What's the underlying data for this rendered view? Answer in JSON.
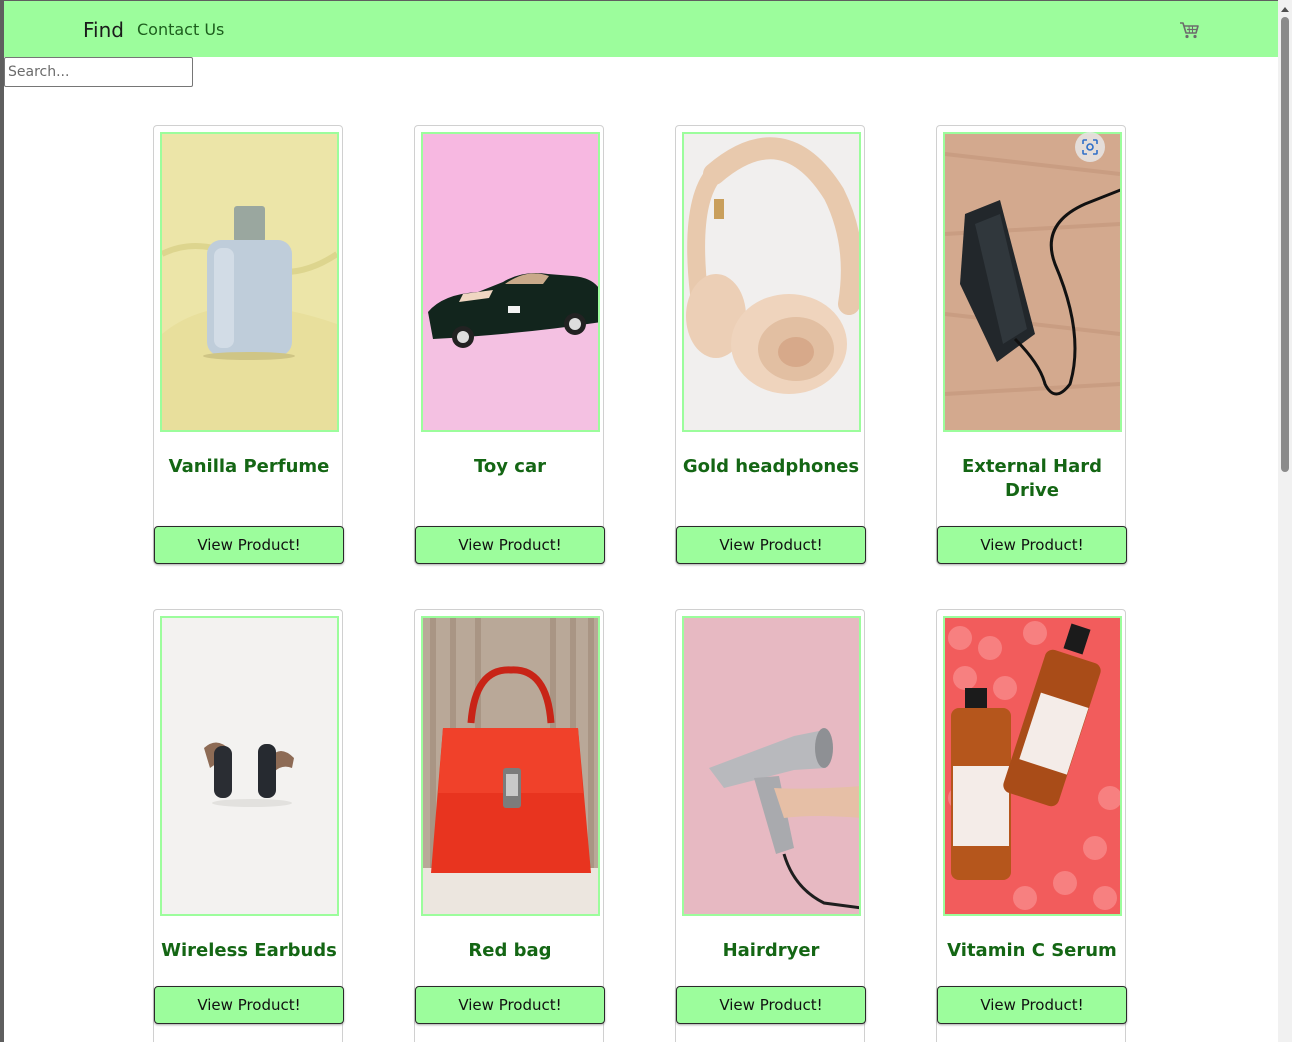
{
  "navbar": {
    "brand": "Find",
    "links": [
      "Contact Us"
    ],
    "cart_icon": "shopping-cart-icon",
    "background": "#9cfd9c"
  },
  "search": {
    "placeholder": "Search...",
    "value": ""
  },
  "colors": {
    "accent": "#9cfd9c",
    "title_text": "#146614"
  },
  "products": [
    {
      "title": "Vanilla Perfume",
      "button_label": "View Product!"
    },
    {
      "title": "Toy car",
      "button_label": "View Product!"
    },
    {
      "title": "Gold headphones",
      "button_label": "View Product!"
    },
    {
      "title": "External Hard Drive",
      "button_label": "View Product!"
    },
    {
      "title": "Wireless Earbuds",
      "button_label": "View Product!"
    },
    {
      "title": "Red bag",
      "button_label": "View Product!"
    },
    {
      "title": "Hairdryer",
      "button_label": "View Product!"
    },
    {
      "title": "Vitamin C Serum",
      "button_label": "View Product!"
    }
  ]
}
